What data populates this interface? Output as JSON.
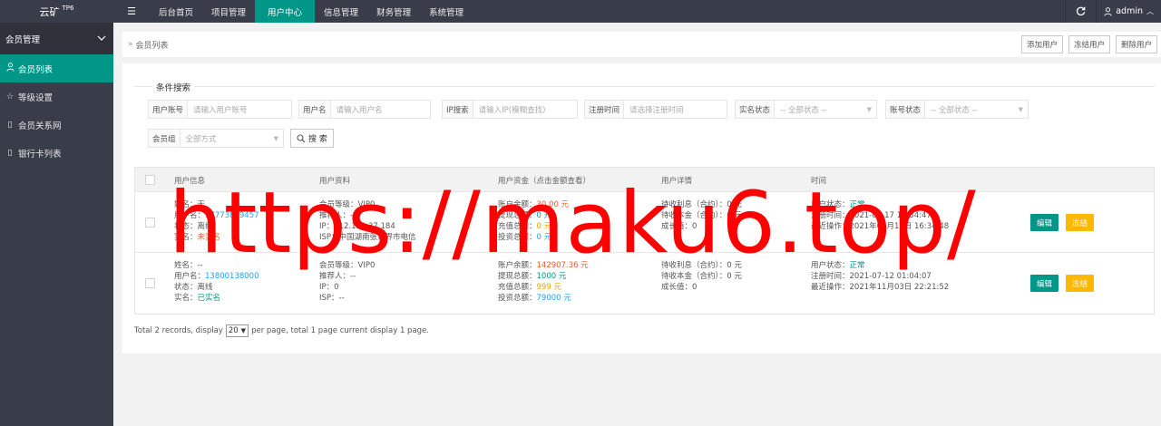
{
  "app": {
    "logo_text": "云矿",
    "logo_sup": "TP6"
  },
  "topnav": {
    "items": [
      {
        "label": "后台首页"
      },
      {
        "label": "项目管理"
      },
      {
        "label": "用户中心"
      },
      {
        "label": "信息管理"
      },
      {
        "label": "财务管理"
      },
      {
        "label": "系统管理"
      }
    ],
    "active_index": 2,
    "user": "admin"
  },
  "sidebar": {
    "group_label": "会员管理",
    "items": [
      {
        "label": "会员列表"
      },
      {
        "label": "等级设置"
      },
      {
        "label": "会员关系网"
      },
      {
        "label": "银行卡列表"
      }
    ]
  },
  "breadcrumb": "会员列表",
  "actions": {
    "add": "添加用户",
    "freeze": "冻结用户",
    "delete": "删除用户"
  },
  "search": {
    "legend": "条件搜索",
    "account": {
      "label": "用户账号",
      "placeholder": "请输入用户账号"
    },
    "username": {
      "label": "用户名",
      "placeholder": "请输入用户名"
    },
    "ip": {
      "label": "IP搜索",
      "placeholder": "请输入IP(模糊查找)"
    },
    "regtime": {
      "label": "注册时间",
      "placeholder": "请选择注册时间"
    },
    "realname_status": {
      "label": "实名状态",
      "value": "-- 全部状态 --"
    },
    "account_status": {
      "label": "账号状态",
      "value": "-- 全部状态 --"
    },
    "group": {
      "label": "会员组",
      "value": "全部方式"
    },
    "button": "搜 索"
  },
  "table": {
    "headers": [
      "用户信息",
      "用户资料",
      "用户资金（点击金额查看）",
      "用户详情",
      "时间"
    ],
    "rows": [
      {
        "info": {
          "name_label": "姓名：",
          "name": "无",
          "username_label": "用户名：",
          "username": "17773819457",
          "status_label": "状态：",
          "status": "离线",
          "realname_label": "实名：",
          "realname": "未实名"
        },
        "profile": {
          "level_label": "会员等级：",
          "level": "VIP0",
          "ref_label": "推荐人：",
          "ref": "--",
          "ip_label": "IP：",
          "ip": "112.153.37.184",
          "isp_label": "ISP：",
          "isp": "中国湖南张家界市电信"
        },
        "funds": {
          "balance_label": "账户余额：",
          "balance": "30.00 元",
          "withdraw_label": "提现总额：",
          "withdraw": "0 元",
          "recharge_label": "充值总额：",
          "recharge": "0 元",
          "invest_label": "投资总额：",
          "invest": "0 元"
        },
        "detail": {
          "interest_label": "待收利息（合约）：",
          "interest": "0 元",
          "principal_label": "待收本金（合约）：",
          "principal": "0 元",
          "growth_label": "成长值：",
          "growth": "0"
        },
        "time": {
          "status_label": "用户状态：",
          "status": "正常",
          "reg_label": "注册时间：",
          "reg": "2021-07-17 16:34:47",
          "last_label": "最近操作：",
          "last": "2021年07月17日 16:34:48"
        },
        "edit": "编辑",
        "freeze": "冻结"
      },
      {
        "info": {
          "name_label": "姓名：",
          "name": "--",
          "username_label": "用户名：",
          "username": "13800138000",
          "status_label": "状态：",
          "status": "离线",
          "realname_label": "实名：",
          "realname": "已实名"
        },
        "profile": {
          "level_label": "会员等级：",
          "level": "VIP0",
          "ref_label": "推荐人：",
          "ref": "--",
          "ip_label": "IP：",
          "ip": "0",
          "isp_label": "ISP：",
          "isp": "--"
        },
        "funds": {
          "balance_label": "账户余额：",
          "balance": "142907.36 元",
          "withdraw_label": "提现总额：",
          "withdraw": "1000 元",
          "recharge_label": "充值总额：",
          "recharge": "999 元",
          "invest_label": "投资总额：",
          "invest": "79000 元"
        },
        "detail": {
          "interest_label": "待收利息（合约）：",
          "interest": "0 元",
          "principal_label": "待收本金（合约）：",
          "principal": "0 元",
          "growth_label": "成长值：",
          "growth": "0"
        },
        "time": {
          "status_label": "用户状态：",
          "status": "正常",
          "reg_label": "注册时间：",
          "reg": "2021-07-12 01:04:07",
          "last_label": "最近操作：",
          "last": "2021年11月03日 22:21:52"
        },
        "edit": "编辑",
        "freeze": "冻结"
      }
    ]
  },
  "pager": {
    "prefix": "Total 2 records, display",
    "page_size": "20",
    "suffix": "per page, total 1 page current display 1 page."
  },
  "watermark": "https://maku6.top/"
}
